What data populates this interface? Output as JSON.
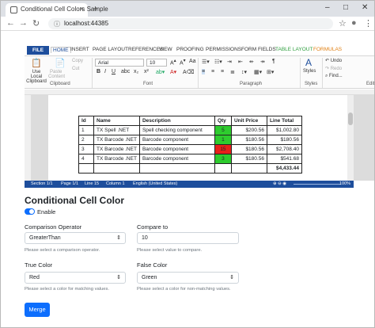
{
  "browser": {
    "tab_title": "Conditional Cell Colors Sample",
    "tab_close": "×",
    "new_tab": "+",
    "url": "localhost:44385",
    "back_glyph": "←",
    "forward_glyph": "→",
    "reload_glyph": "↻",
    "info_glyph": "ⓘ",
    "star_glyph": "☆",
    "account_glyph": "●",
    "menu_glyph": "⋮",
    "minimize": "–",
    "maximize": "□",
    "close": "✕"
  },
  "ribbon": {
    "tabs": [
      "FILE",
      "HOME",
      "INSERT",
      "PAGE LAYOUT",
      "REFERENCES",
      "VIEW",
      "PROOFING",
      "PERMISSIONS",
      "FORM FIELDS",
      "TABLE LAYOUT",
      "FORMULAS"
    ],
    "use_local_clipboard": "Use Local Clipboard",
    "paste": "Paste",
    "paste_sub": "Content",
    "copy": "Copy",
    "cut": "Cut",
    "clipboard_group": "Clipboard",
    "font_name": "Arial",
    "font_size": "10",
    "font_group": "Font",
    "paragraph_group": "Paragraph",
    "styles": "Styles",
    "styles_group": "Styles",
    "undo": "Undo",
    "redo": "Redo",
    "find": "Find...",
    "edit_group": "Edit"
  },
  "table": {
    "headers": [
      "Id",
      "Name",
      "Description",
      "Qty",
      "Unit Price",
      "Line Total"
    ],
    "rows": [
      [
        "1",
        "TX Spell .NET",
        "Spell checking component",
        "5",
        "$200.56",
        "$1,002.80"
      ],
      [
        "2",
        "TX Barcode .NET",
        "Barcode component",
        "1",
        "$180.56",
        "$180.56"
      ],
      [
        "3",
        "TX Barcode .NET",
        "Barcode component",
        "15",
        "$180.56",
        "$2,708.40"
      ],
      [
        "4",
        "TX Barcode .NET",
        "Barcode component",
        "3",
        "$180.56",
        "$541.68"
      ]
    ],
    "total": "$4,433.44",
    "qty_colors": [
      "#2ecc2e",
      "#2ecc2e",
      "#e8201a",
      "#2ecc2e"
    ]
  },
  "statusbar": {
    "section": "Section 1/1",
    "page": "Page 1/1",
    "line": "Line 15",
    "column": "Column 1",
    "language": "English (United States)",
    "zoom": "100%"
  },
  "form": {
    "title": "Conditional Cell Color",
    "enable_label": "Enable",
    "comparison_operator_label": "Comparison Operator",
    "comparison_operator_value": "GreaterThan",
    "comparison_operator_help": "Please select a comparison operator.",
    "compare_to_label": "Compare to",
    "compare_to_value": "10",
    "compare_to_help": "Please select value to compare.",
    "true_color_label": "True Color",
    "true_color_value": "Red",
    "true_color_help": "Please select a color for matching values.",
    "false_color_label": "False Color",
    "false_color_value": "Green",
    "false_color_help": "Please select a color for non-matching values.",
    "merge_button": "Merge"
  }
}
